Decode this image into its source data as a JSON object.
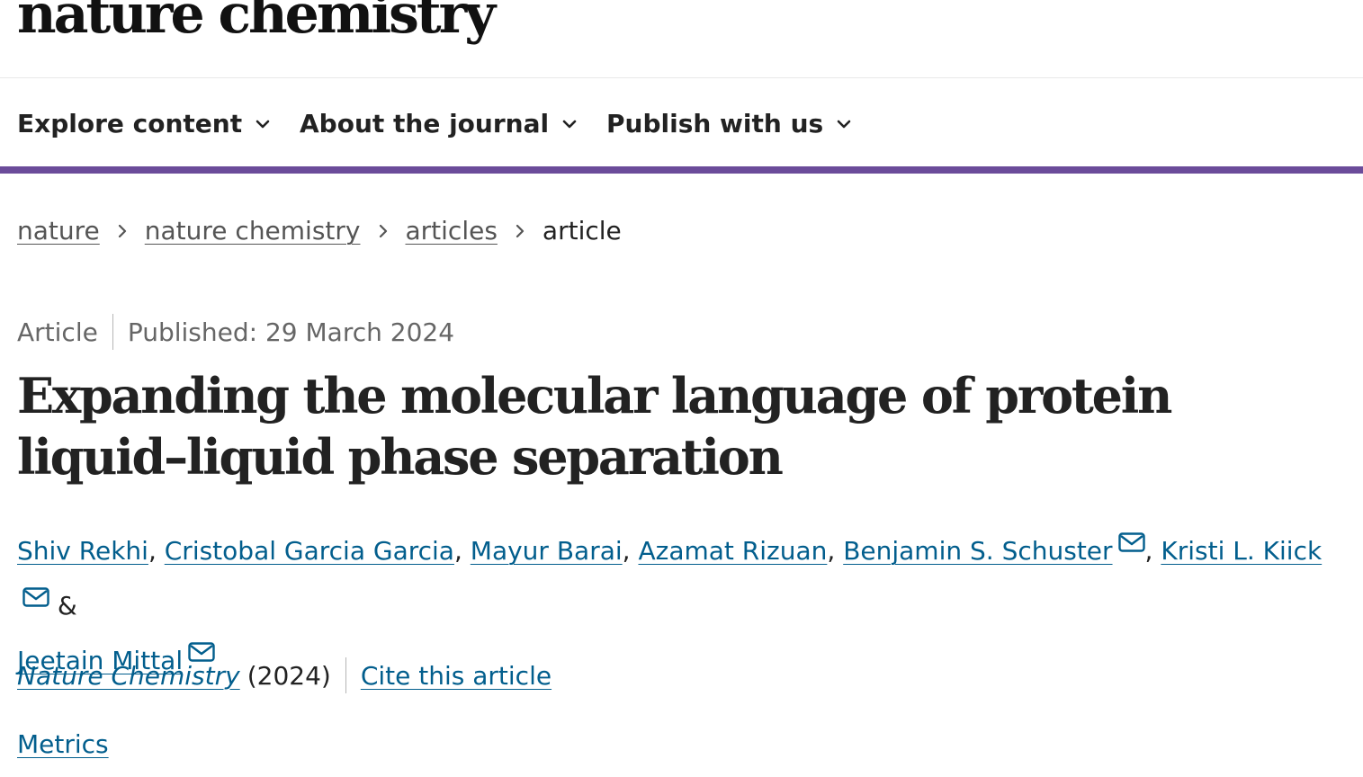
{
  "header": {
    "logo_text": "nature chemistry"
  },
  "nav": {
    "items": [
      {
        "label": "Explore content",
        "icon": "chevron-down-icon"
      },
      {
        "label": "About the journal",
        "icon": "chevron-down-icon"
      },
      {
        "label": "Publish with us",
        "icon": "chevron-down-icon"
      }
    ],
    "accent_color": "#6b4c9a"
  },
  "breadcrumb": {
    "items": [
      "nature",
      "nature chemistry",
      "articles"
    ],
    "current": "article",
    "separator_icon": "chevron-right-icon"
  },
  "article": {
    "type": "Article",
    "published": "Published: 29 March 2024",
    "title": "Expanding the molecular language of protein liquid–liquid phase separation",
    "authors": [
      {
        "name": "Shiv Rekhi",
        "corresponding": false
      },
      {
        "name": "Cristobal Garcia Garcia",
        "corresponding": false
      },
      {
        "name": "Mayur Barai",
        "corresponding": false
      },
      {
        "name": "Azamat Rizuan",
        "corresponding": false
      },
      {
        "name": "Benjamin S. Schuster",
        "corresponding": true
      },
      {
        "name": "Kristi L. Kiick",
        "corresponding": true
      },
      {
        "name": "Jeetain Mittal",
        "corresponding": true
      }
    ],
    "author_separator": ",",
    "author_conjunction": "&",
    "mail_icon": "envelope-icon",
    "journal": "Nature Chemistry",
    "year": "(2024)",
    "cite_label": "Cite this article",
    "metrics_label": "Metrics",
    "link_color": "#025e8d"
  }
}
